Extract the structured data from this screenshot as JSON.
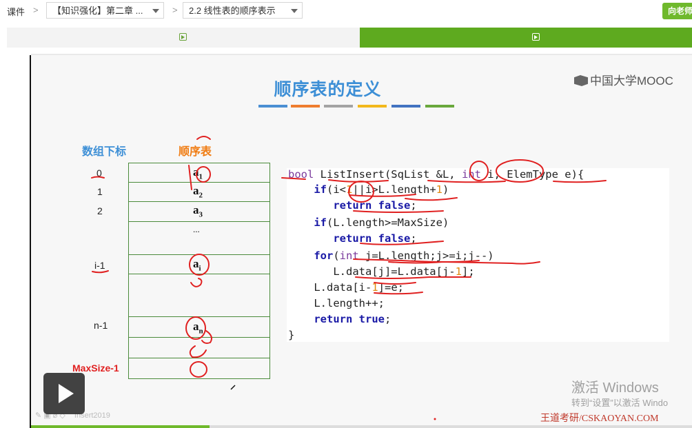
{
  "breadcrumb": {
    "root": "课件",
    "chapter": "【知识强化】第二章 ...",
    "section": "2.2 线性表的顺序表示"
  },
  "teacher_button": "向老师",
  "tabs": [
    {
      "icon": "video-play-icon",
      "active": false
    },
    {
      "icon": "video-play-icon",
      "active": true
    }
  ],
  "colors": {
    "accent_green": "#5eaa1f",
    "title_blue": "#3d8fd6",
    "annotation_red": "#e02020",
    "strip": [
      "#4b8fd3",
      "#ee7d2f",
      "#a3a3a3",
      "#f2b81c",
      "#4273c1",
      "#69a83c"
    ]
  },
  "slide": {
    "title": "顺序表的定义",
    "logo": "中国大学MOOC",
    "index_header": "数组下标",
    "seq_header": "顺序表",
    "indices": [
      "0",
      "1",
      "2",
      "i-1",
      "n-1",
      "MaxSize-1"
    ],
    "cells": [
      {
        "base": "a",
        "sub": "1"
      },
      {
        "base": "a",
        "sub": "2"
      },
      {
        "base": "a",
        "sub": "3"
      },
      {
        "base": "...",
        "sub": ""
      },
      {
        "base": "a",
        "sub": "i"
      },
      {
        "base": "",
        "sub": ""
      },
      {
        "base": "a",
        "sub": "n"
      },
      {
        "base": "",
        "sub": ""
      },
      {
        "base": "",
        "sub": ""
      }
    ],
    "code_lines": [
      "bool ListInsert(SqList &L, int i, ElemType e){",
      "    if(i<1||i>L.length+1)",
      "       return false;",
      "    if(L.length>=MaxSize)",
      "       return false;",
      "    for(int j=L.length;j>=i;j--)",
      "       L.data[j]=L.data[j-1];",
      "    L.data[i-1]=e;",
      "    L.length++;",
      "    return true;",
      "}"
    ],
    "watermark_title": "激活 Windows",
    "watermark_sub": "转到“设置”以激活 Windo",
    "signature": "王道考研/CSKAOYAN.COM",
    "toolbar_text": "Insert2019"
  },
  "player": {
    "progress": 0.27
  }
}
